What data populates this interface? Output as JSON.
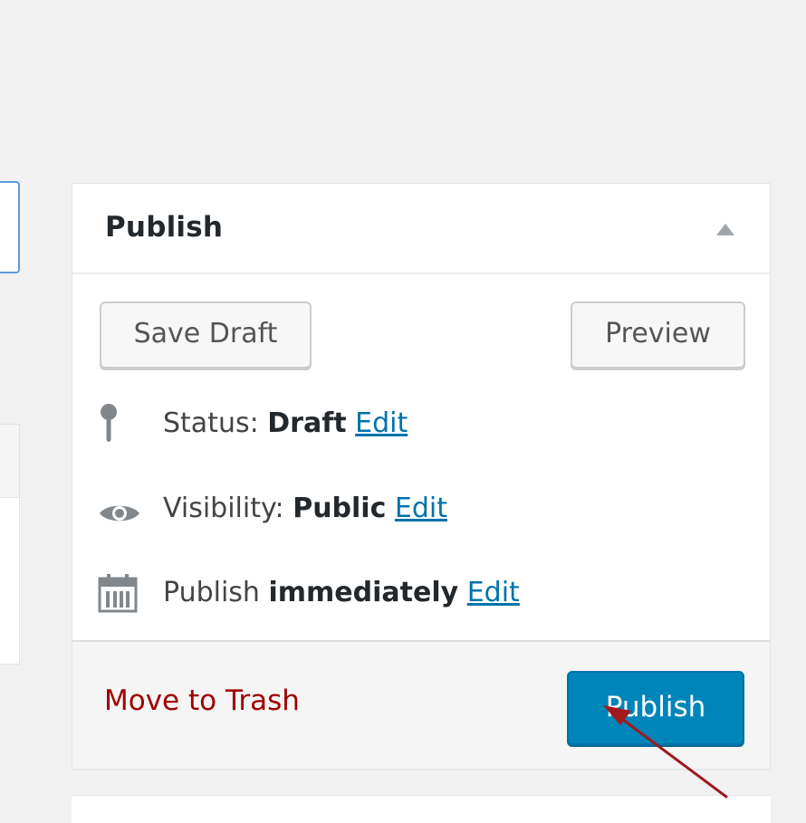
{
  "publish_box": {
    "title": "Publish",
    "save_draft_label": "Save Draft",
    "preview_label": "Preview",
    "status": {
      "label": "Status: ",
      "value": "Draft",
      "edit_label": "Edit"
    },
    "visibility": {
      "label": "Visibility: ",
      "value": "Public",
      "edit_label": "Edit"
    },
    "schedule": {
      "label": "Publish ",
      "value": "immediately",
      "edit_label": "Edit"
    },
    "trash_label": "Move to Trash",
    "publish_label": "Publish"
  },
  "icons": {
    "toggle": "triangle-up-icon",
    "status": "pin-icon",
    "visibility": "eye-icon",
    "schedule": "calendar-icon"
  },
  "colors": {
    "background": "#f1f1f1",
    "link": "#0073aa",
    "trash": "#a00000",
    "primary_button": "#0085ba",
    "annotation_arrow": "#a0191e"
  }
}
